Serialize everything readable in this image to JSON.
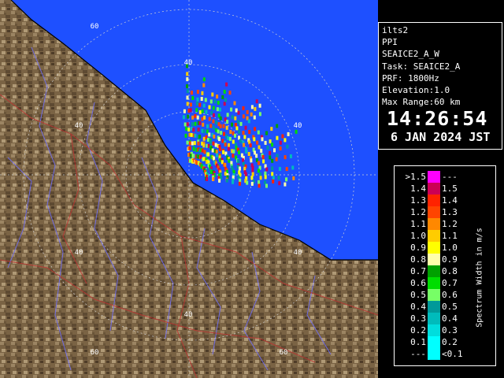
{
  "info": {
    "site": "ilts2",
    "product": "PPI",
    "scan": "SEAICE2_A_W",
    "task": "Task: SEAICE2_A",
    "prf": "PRF: 1800Hz",
    "elevation": "Elevation:1.0",
    "max_range": "Max Range:60 km",
    "time": "14:26:54",
    "date": "6 JAN 2024 JST"
  },
  "legend": {
    "unit": "Spectrum Width in m/s",
    "rows": [
      {
        "label": ">1.5",
        "color": "#ff00ff",
        "value": "---"
      },
      {
        "label": "1.4",
        "color": "#cc0055",
        "value": "1.5"
      },
      {
        "label": "1.3",
        "color": "#ff2200",
        "value": "1.4"
      },
      {
        "label": "1.2",
        "color": "#ff4400",
        "value": "1.3"
      },
      {
        "label": "1.1",
        "color": "#ff8800",
        "value": "1.2"
      },
      {
        "label": "1.0",
        "color": "#ffcc00",
        "value": "1.1"
      },
      {
        "label": "0.9",
        "color": "#ffff00",
        "value": "1.0"
      },
      {
        "label": "0.8",
        "color": "#ffffaa",
        "value": "0.9"
      },
      {
        "label": "0.7",
        "color": "#00a000",
        "value": "0.8"
      },
      {
        "label": "0.6",
        "color": "#00dd00",
        "value": "0.7"
      },
      {
        "label": "0.5",
        "color": "#77ff66",
        "value": "0.6"
      },
      {
        "label": "0.4",
        "color": "#009999",
        "value": "0.5"
      },
      {
        "label": "0.3",
        "color": "#00bbbb",
        "value": "0.4"
      },
      {
        "label": "0.2",
        "color": "#00dddd",
        "value": "0.3"
      },
      {
        "label": "0.1",
        "color": "#00ffff",
        "value": "0.2"
      },
      {
        "label": "---",
        "color": "#00ffff",
        "value": "<0.1"
      }
    ]
  },
  "map": {
    "range_labels": [
      "40",
      "60"
    ],
    "sea_color": "#1e50ff",
    "land_color": "#7a6344"
  }
}
